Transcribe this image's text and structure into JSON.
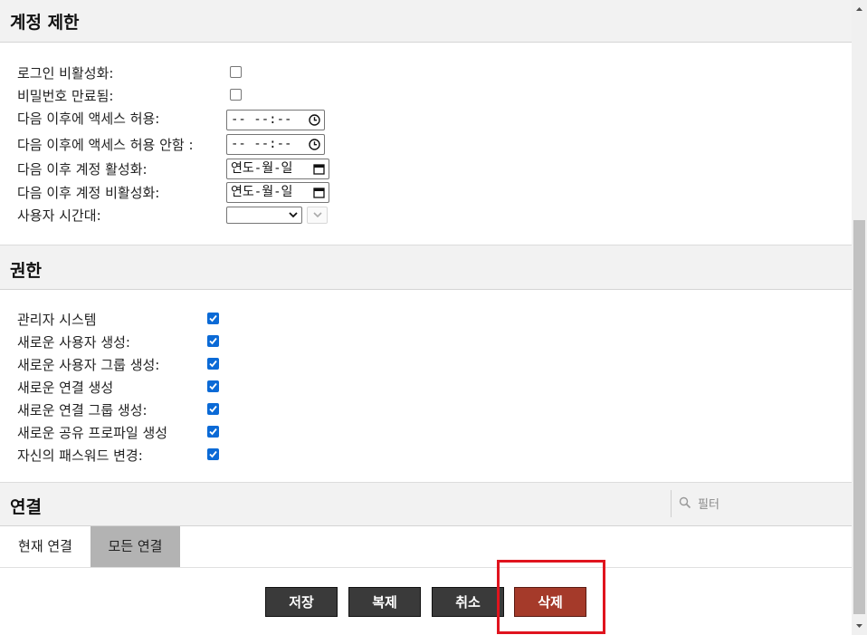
{
  "sections": {
    "account_restrictions": "계정 제한",
    "permissions": "권한",
    "connections": "연결"
  },
  "restrictions": {
    "login_disabled": "로그인 비활성화:",
    "password_expired": "비밀번호 만료됨:",
    "allow_access_after": "다음 이후에 액세스 허용:",
    "deny_access_after": "다음 이후에 액세스 허용 안함 :",
    "enable_account_after": "다음 이후 계정 활성화:",
    "disable_account_after": "다음 이후 계정 비활성화:",
    "timezone": "사용자 시간대:",
    "time_placeholder": "-- --:--",
    "date_placeholder": "연도-월-일"
  },
  "permissions": {
    "items": [
      {
        "label": "관리자 시스템",
        "checked": true
      },
      {
        "label": "새로운 사용자 생성:",
        "checked": true
      },
      {
        "label": "새로운 사용자 그룹 생성:",
        "checked": true
      },
      {
        "label": "새로운 연결 생성",
        "checked": true
      },
      {
        "label": "새로운 연결 그룹 생성:",
        "checked": true
      },
      {
        "label": "새로운 공유 프로파일 생성",
        "checked": true
      },
      {
        "label": "자신의 패스워드 변경:",
        "checked": true
      }
    ]
  },
  "connections": {
    "filter_placeholder": "필터",
    "tabs": [
      {
        "label": "현재 연결",
        "active": false
      },
      {
        "label": "모든 연결",
        "active": true
      }
    ]
  },
  "actions": {
    "save": "저장",
    "clone": "복제",
    "cancel": "취소",
    "delete": "삭제"
  },
  "colors": {
    "dark_button": "#3a3a3a",
    "delete_button": "#a53a2a",
    "highlight": "#e0141e",
    "checkbox": "#0b6ad6"
  },
  "icons": [
    "clock-icon",
    "calendar-icon",
    "search-icon",
    "chevron-down-icon",
    "checkmark-icon"
  ]
}
